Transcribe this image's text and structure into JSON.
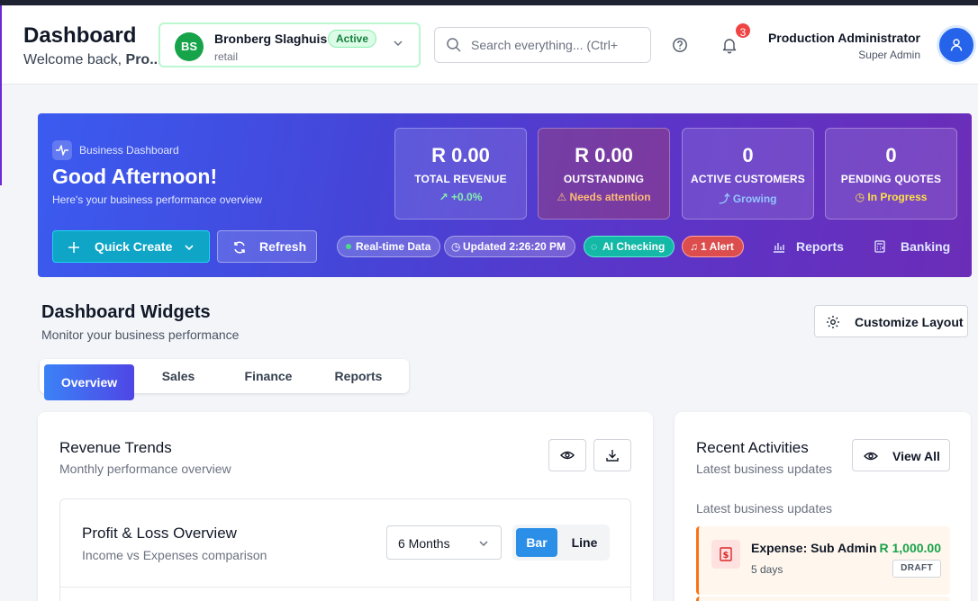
{
  "header": {
    "title": "Dashboard",
    "subtitle_prefix": "Welcome back, ",
    "subtitle_name": "Pro...",
    "business": {
      "initials": "BS",
      "name": "Bronberg Slaghuis",
      "status": "Active",
      "type": "retail"
    },
    "search_placeholder": "Search everything... (Ctrl+",
    "notifications_count": "3",
    "user": {
      "name": "Production Administrator",
      "role": "Super Admin"
    }
  },
  "hero": {
    "tag": "Business Dashboard",
    "greeting": "Good Afternoon!",
    "description": "Here's your business performance overview",
    "stats": [
      {
        "value": "R 0.00",
        "label": "TOTAL REVENUE",
        "change": "+0.0%",
        "change_color": "#86efac"
      },
      {
        "value": "R 0.00",
        "label": "OUTSTANDING",
        "change": "Needs attention",
        "change_color": "#fdba74"
      },
      {
        "value": "0",
        "label": "ACTIVE CUSTOMERS",
        "change": "Growing",
        "change_color": "#93c5fd"
      },
      {
        "value": "0",
        "label": "PENDING QUOTES",
        "change": "In Progress",
        "change_color": "#fde047"
      }
    ],
    "quick_create": "Quick Create",
    "refresh": "Refresh",
    "pills": {
      "realtime": "Real-time Data",
      "updated": "Updated 2:26:20 PM",
      "ai": "AI Checking",
      "alert": "1 Alert"
    },
    "links": {
      "reports": "Reports",
      "banking": "Banking"
    }
  },
  "widgets": {
    "title": "Dashboard Widgets",
    "subtitle": "Monitor your business performance",
    "customize": "Customize Layout",
    "tabs": [
      "Overview",
      "Sales",
      "Finance",
      "Reports"
    ]
  },
  "revenue": {
    "title": "Revenue Trends",
    "subtitle": "Monthly performance overview",
    "pl_title": "Profit & Loss Overview",
    "pl_subtitle": "Income vs Expenses comparison",
    "period": "6 Months",
    "toggle": {
      "bar": "Bar",
      "line": "Line"
    }
  },
  "activities": {
    "title": "Recent Activities",
    "subtitle": "Latest business updates",
    "view_all": "View All",
    "section_label": "Latest business updates",
    "items": [
      {
        "title": "Expense: Sub Admin",
        "amount": "R 1,000.00",
        "when": "5 days",
        "status": "DRAFT"
      }
    ]
  }
}
